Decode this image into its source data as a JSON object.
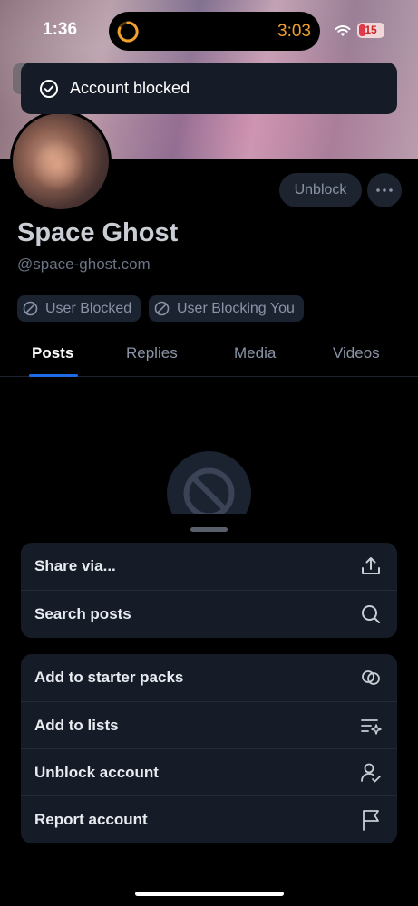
{
  "status_bar": {
    "time": "1:36",
    "timer": "3:03",
    "battery": "15"
  },
  "toast": {
    "text": "Account blocked",
    "icon": "check-circle-icon"
  },
  "profile": {
    "unblock_label": "Unblock",
    "name": "Space Ghost",
    "handle": "@space-ghost.com",
    "pills": [
      {
        "label": "User Blocked",
        "icon": "ban-icon"
      },
      {
        "label": "User Blocking You",
        "icon": "ban-icon"
      }
    ]
  },
  "tabs": [
    {
      "label": "Posts",
      "active": true
    },
    {
      "label": "Replies",
      "active": false
    },
    {
      "label": "Media",
      "active": false
    },
    {
      "label": "Videos",
      "active": false
    }
  ],
  "menu": {
    "group1": [
      {
        "label": "Share via...",
        "icon": "share-icon"
      },
      {
        "label": "Search posts",
        "icon": "search-icon"
      }
    ],
    "group2": [
      {
        "label": "Add to starter packs",
        "icon": "starter-pack-icon"
      },
      {
        "label": "Add to lists",
        "icon": "list-add-icon"
      },
      {
        "label": "Unblock account",
        "icon": "person-check-icon"
      },
      {
        "label": "Report account",
        "icon": "flag-icon"
      }
    ]
  },
  "colors": {
    "accent": "#1f6ae6",
    "surface": "#161c27",
    "timer": "#f0a030"
  }
}
